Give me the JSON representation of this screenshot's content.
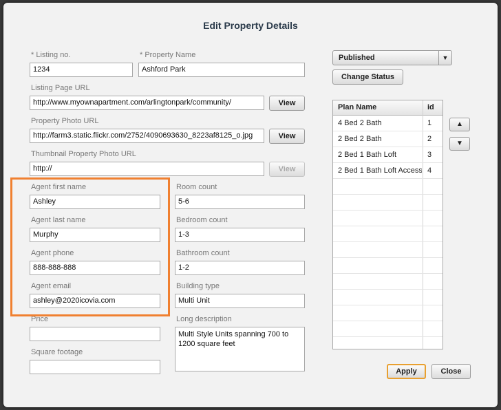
{
  "dialog": {
    "title": "Edit Property Details"
  },
  "fields": {
    "listing_no": {
      "label": "* Listing no.",
      "value": "1234"
    },
    "property_name": {
      "label": "* Property Name",
      "value": "Ashford Park"
    },
    "listing_url": {
      "label": "Listing Page URL",
      "value": "http://www.myownapartment.com/arlingtonpark/community/"
    },
    "photo_url": {
      "label": "Property Photo URL",
      "value": "http://farm3.static.flickr.com/2752/4090693630_8223af8125_o.jpg"
    },
    "thumb_url": {
      "label": "Thumbnail Property Photo URL",
      "value": "http://"
    },
    "agent_first": {
      "label": "Agent first name",
      "value": "Ashley"
    },
    "agent_last": {
      "label": "Agent last name",
      "value": "Murphy"
    },
    "agent_phone": {
      "label": "Agent phone",
      "value": "888-888-888"
    },
    "agent_email": {
      "label": "Agent email",
      "value": "ashley@2020icovia.com"
    },
    "price": {
      "label": "Price",
      "value": ""
    },
    "square_footage": {
      "label": "Square footage",
      "value": ""
    },
    "room_count": {
      "label": "Room count",
      "value": "5-6"
    },
    "bedroom_count": {
      "label": "Bedroom count",
      "value": "1-3"
    },
    "bathroom_count": {
      "label": "Bathroom count",
      "value": "1-2"
    },
    "building_type": {
      "label": "Building type",
      "value": "Multi Unit"
    },
    "long_description": {
      "label": "Long description",
      "value": "Multi Style Units spanning 700 to 1200 square feet"
    }
  },
  "buttons": {
    "view_listing": "View",
    "view_photo": "View",
    "view_thumb": "View",
    "change_status": "Change Status",
    "apply": "Apply",
    "close": "Close",
    "move_up": "▲",
    "move_down": "▼"
  },
  "status": {
    "selected": "Published",
    "arrow": "▼"
  },
  "plans": {
    "columns": [
      "Plan Name",
      "id"
    ],
    "rows": [
      {
        "name": "4 Bed 2 Bath",
        "id": "1"
      },
      {
        "name": "2 Bed 2 Bath",
        "id": "2"
      },
      {
        "name": "2 Bed 1 Bath Loft",
        "id": "3"
      },
      {
        "name": "2 Bed 1 Bath Loft Access",
        "id": "4"
      }
    ]
  },
  "colors": {
    "highlight": "#f08030",
    "apply_border": "#e8a030"
  }
}
